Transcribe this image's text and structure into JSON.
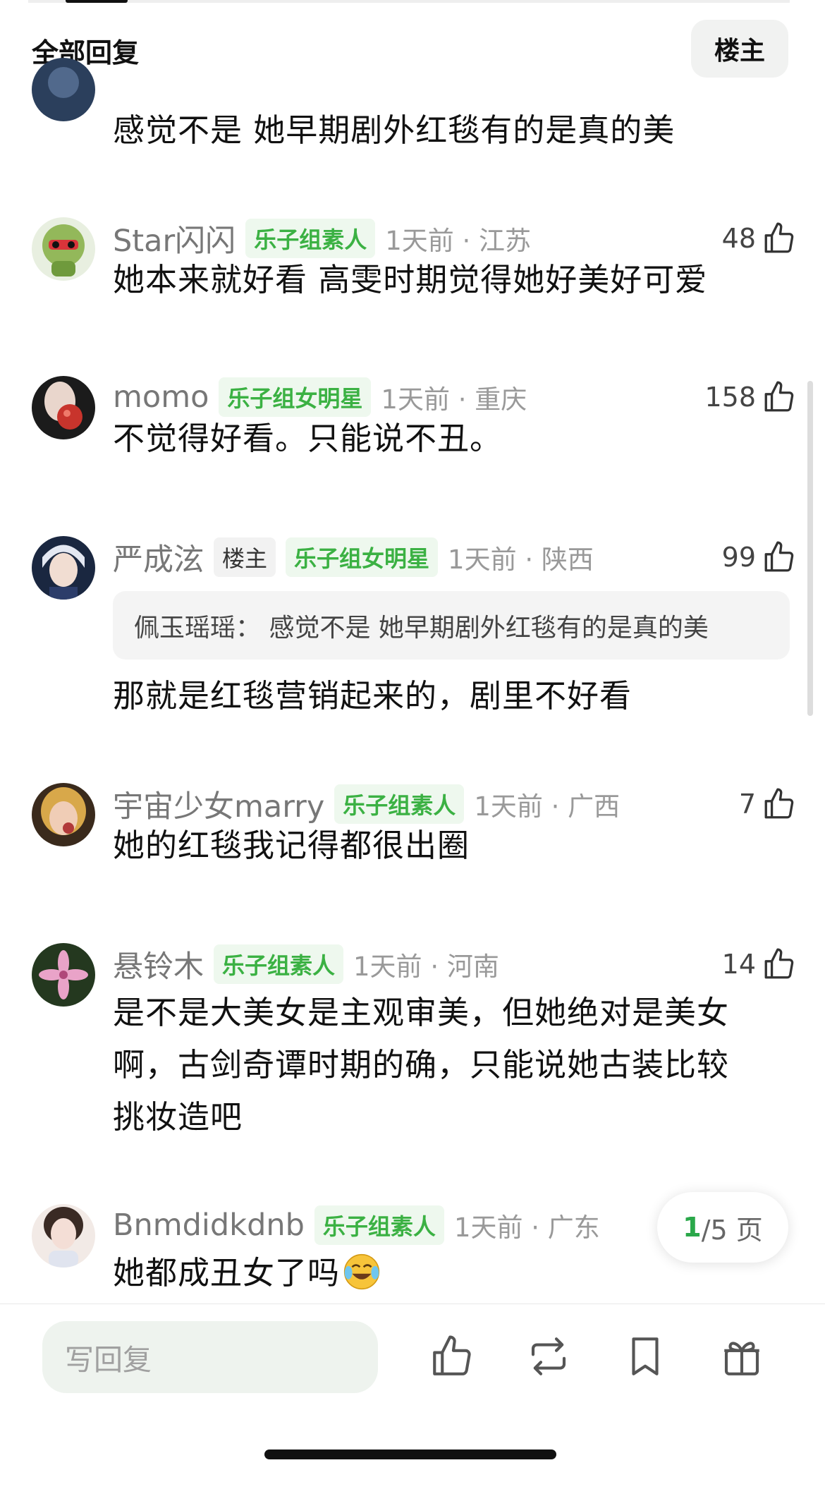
{
  "header": {
    "title": "全部回复",
    "op_filter_label": "楼主"
  },
  "top_partial_comment": {
    "text": "感觉不是 她早期剧外红毯有的是真的美"
  },
  "comments": [
    {
      "username": "Star闪闪",
      "badges": [
        "乐子组素人"
      ],
      "time": "1天前",
      "location": "江苏",
      "likes": "48",
      "text": "她本来就好看 高雯时期觉得她好美好可爱"
    },
    {
      "username": "momo",
      "badges": [
        "乐子组女明星"
      ],
      "time": "1天前",
      "location": "重庆",
      "likes": "158",
      "text": "不觉得好看。只能说不丑。"
    },
    {
      "username": "严成泫",
      "op_label": "楼主",
      "badges": [
        "乐子组女明星"
      ],
      "time": "1天前",
      "location": "陕西",
      "likes": "99",
      "quote": "佩玉瑶瑶：  感觉不是 她早期剧外红毯有的是真的美",
      "text": "那就是红毯营销起来的，剧里不好看"
    },
    {
      "username": "宇宙少女marry",
      "badges": [
        "乐子组素人"
      ],
      "time": "1天前",
      "location": "广西",
      "likes": "7",
      "text": "她的红毯我记得都很出圈"
    },
    {
      "username": "悬铃木",
      "badges": [
        "乐子组素人"
      ],
      "time": "1天前",
      "location": "河南",
      "likes": "14",
      "text_lines": [
        "是不是大美女是主观审美，但她绝对是美女",
        "啊，古剑奇谭时期的确，只能说她古装比较",
        "挑妆造吧"
      ]
    },
    {
      "username": "Bnmdidkdnb",
      "badges": [
        "乐子组素人"
      ],
      "time": "1天前",
      "location": "广东",
      "text": "她都成丑女了吗",
      "emoji": "laughing-crying-emoji"
    }
  ],
  "pagination": {
    "current": "1",
    "total_text": "/5 页"
  },
  "bottom_bar": {
    "reply_placeholder": "写回复",
    "actions": [
      "like-icon",
      "repost-icon",
      "bookmark-icon",
      "gift-icon"
    ]
  },
  "colors": {
    "accent_green": "#3bb143",
    "badge_bg": "#eef8ee",
    "input_bg": "#eef3ee"
  }
}
